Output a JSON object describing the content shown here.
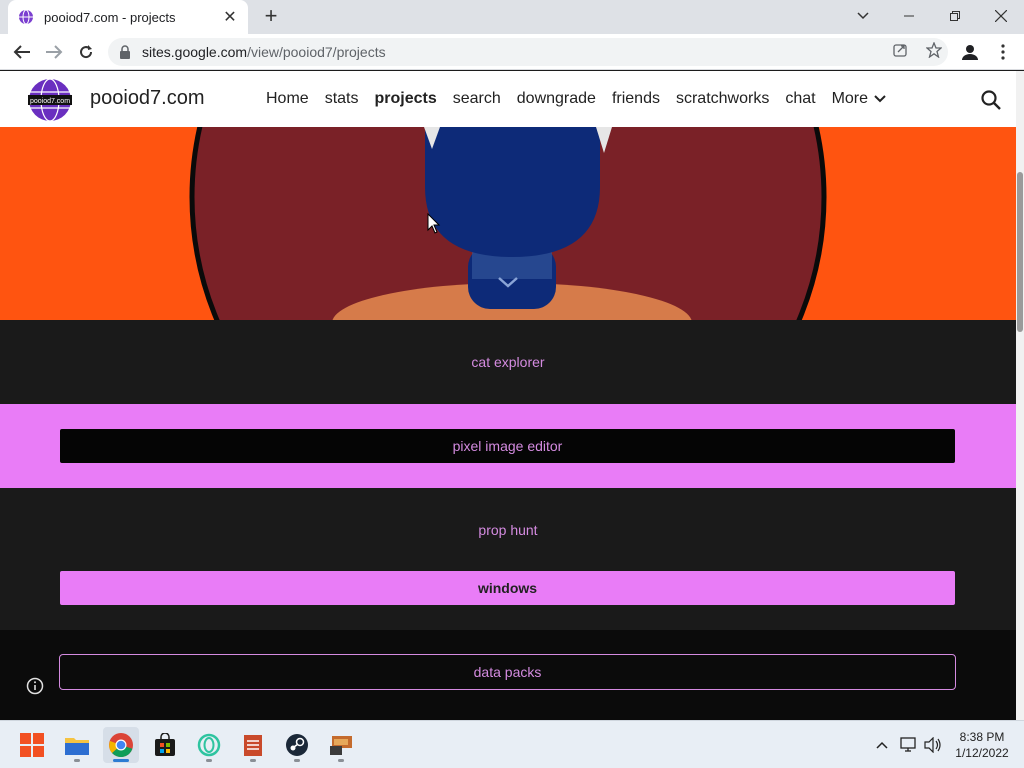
{
  "browser": {
    "tab_title": "pooiod7.com - projects",
    "url_host": "sites.google.com",
    "url_path": "/view/pooiod7/projects"
  },
  "site": {
    "logo_text": "pooiod7.com",
    "name": "pooiod7.com",
    "nav": [
      {
        "label": "Home"
      },
      {
        "label": "stats"
      },
      {
        "label": "projects",
        "active": true
      },
      {
        "label": "search"
      },
      {
        "label": "downgrade"
      },
      {
        "label": "friends"
      },
      {
        "label": "scratchworks"
      },
      {
        "label": "chat"
      },
      {
        "label": "More"
      }
    ]
  },
  "sections": {
    "cat_explorer": "cat explorer",
    "pixel_image_editor": "pixel image editor",
    "prop_hunt": "prop hunt",
    "windows": "windows",
    "data_packs": "data packs"
  },
  "colors": {
    "hero_bg": "#ff5410",
    "pink": "#e97cf7",
    "link": "#d48be0"
  },
  "taskbar": {
    "apps": [
      "windows-start-icon",
      "file-explorer-icon",
      "chrome-icon",
      "store-icon",
      "app-icon",
      "notes-icon",
      "steam-icon",
      "game-icon"
    ],
    "time": "8:38 PM",
    "date": "1/12/2022"
  }
}
